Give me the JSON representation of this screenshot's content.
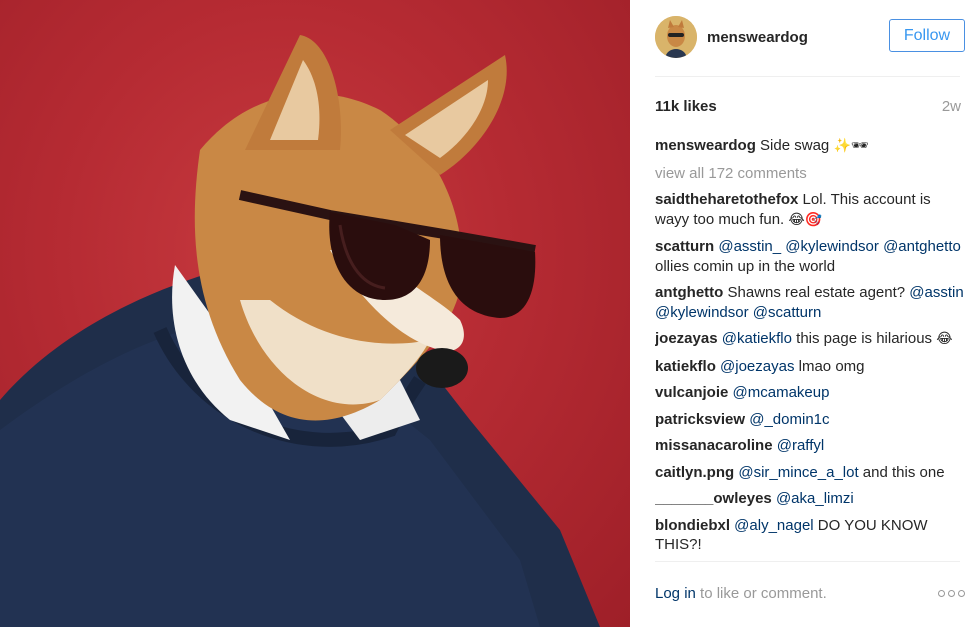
{
  "post": {
    "username": "mensweardog",
    "follow_label": "Follow",
    "likes": "11k likes",
    "time": "2w",
    "caption": {
      "user": "mensweardog",
      "text": "Side swag",
      "emoji": "✨🕶"
    },
    "view_all": "view all 172 comments",
    "comments": [
      {
        "user": "saidtheharetothefox",
        "parts": [
          {
            "t": "text",
            "v": "Lol. This account is wayy too much fun. "
          },
          {
            "t": "emoji",
            "v": "😂🎯"
          }
        ]
      },
      {
        "user": "scatturn",
        "parts": [
          {
            "t": "mention",
            "v": "@asstin_"
          },
          {
            "t": "text",
            "v": " "
          },
          {
            "t": "mention",
            "v": "@kylewindsor"
          },
          {
            "t": "text",
            "v": " "
          },
          {
            "t": "mention",
            "v": "@antghetto"
          },
          {
            "t": "text",
            "v": " ollies comin up in the world"
          }
        ]
      },
      {
        "user": "antghetto",
        "parts": [
          {
            "t": "text",
            "v": "Shawns real estate agent? "
          },
          {
            "t": "mention",
            "v": "@asstin"
          },
          {
            "t": "text",
            "v": " "
          },
          {
            "t": "mention",
            "v": "@kylewindsor"
          },
          {
            "t": "text",
            "v": " "
          },
          {
            "t": "mention",
            "v": "@scatturn"
          }
        ]
      },
      {
        "user": "joezayas",
        "parts": [
          {
            "t": "mention",
            "v": "@katiekflo"
          },
          {
            "t": "text",
            "v": " this page is hilarious "
          },
          {
            "t": "emoji",
            "v": "😂"
          }
        ]
      },
      {
        "user": "katiekflo",
        "parts": [
          {
            "t": "mention",
            "v": "@joezayas"
          },
          {
            "t": "text",
            "v": " lmao omg"
          }
        ]
      },
      {
        "user": "vulcanjoie",
        "parts": [
          {
            "t": "mention",
            "v": "@mcamakeup"
          }
        ]
      },
      {
        "user": "patricksview",
        "parts": [
          {
            "t": "mention",
            "v": "@_domin1c"
          }
        ]
      },
      {
        "user": "missanacaroline",
        "parts": [
          {
            "t": "mention",
            "v": "@raffyl"
          }
        ]
      },
      {
        "user": "caitlyn.png",
        "parts": [
          {
            "t": "mention",
            "v": "@sir_mince_a_lot"
          },
          {
            "t": "text",
            "v": " and this one"
          }
        ]
      },
      {
        "user": "_______owleyes",
        "parts": [
          {
            "t": "mention",
            "v": "@aka_limzi"
          }
        ]
      },
      {
        "user": "blondiebxl",
        "parts": [
          {
            "t": "mention",
            "v": "@aly_nagel"
          },
          {
            "t": "text",
            "v": " DO YOU KNOW THIS?!"
          }
        ]
      }
    ],
    "footer": {
      "login": "Log in",
      "rest": "to like or comment."
    }
  }
}
